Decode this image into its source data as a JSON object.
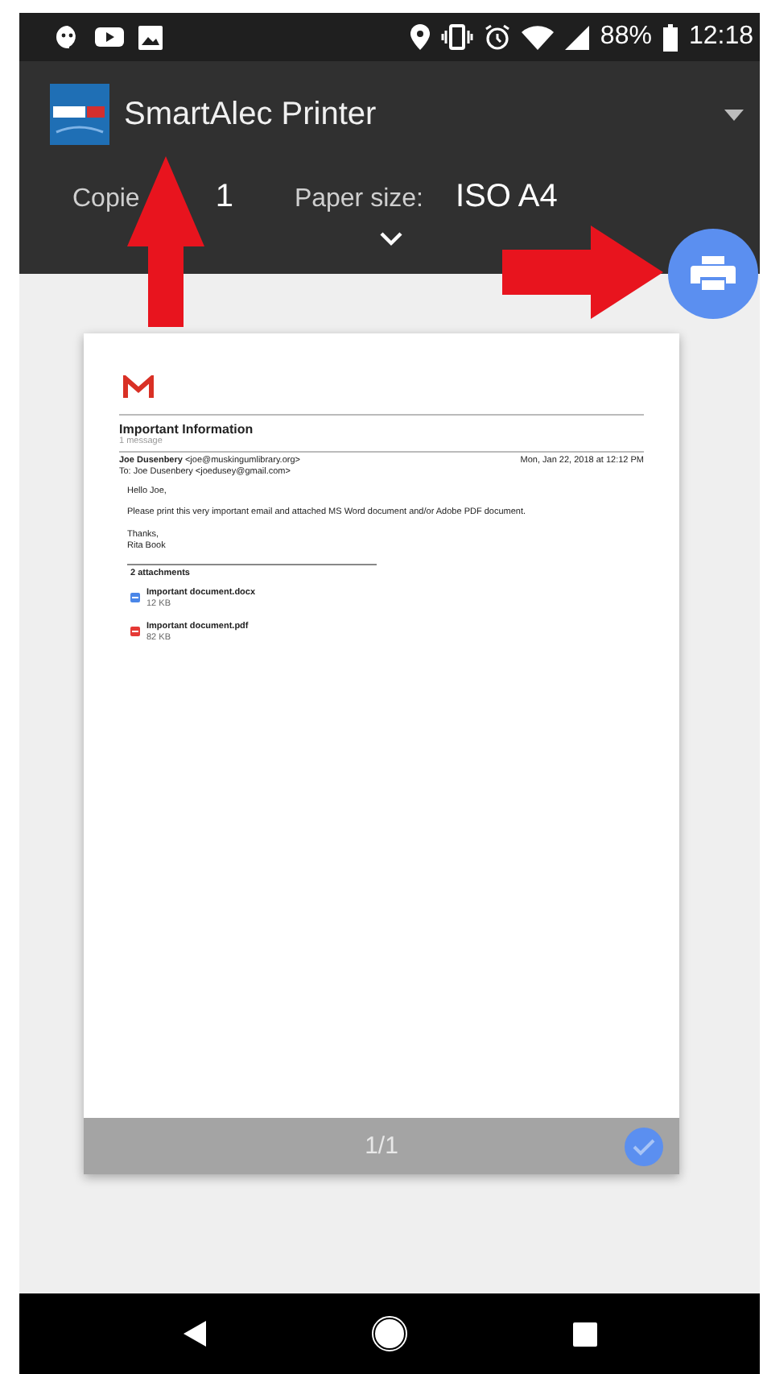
{
  "status_bar": {
    "battery": "88%",
    "time": "12:18"
  },
  "toolbar": {
    "printer_name": "SmartAlec Printer",
    "copies_label": "Copie",
    "copies": "1",
    "paper_label": "Paper size:",
    "paper_size": "ISO A4"
  },
  "preview": {
    "subject": "Important Information",
    "message_count": "1 message",
    "sender": "**Joe Dusenbery** <joe@muskingumlibrary.org>",
    "date": "Mon, Jan 22, 2018 at 12:12 PM",
    "to": "To: Joe Dusenbery <joedusey@gmail.com>",
    "greeting": "Hello Joe,",
    "message": "Please print this very important email and attached MS Word document and/or Adobe PDF document.",
    "closing": [
      "Thanks,",
      "Rita Book"
    ],
    "attachments_title": "2 attachments",
    "attachments": [
      {
        "kind": "word",
        "name": "Important document.docx",
        "size": "12 KB"
      },
      {
        "kind": "pdf",
        "name": "Important document.pdf",
        "size": "82 KB"
      }
    ],
    "page_label": "1/1",
    "selected": true
  }
}
